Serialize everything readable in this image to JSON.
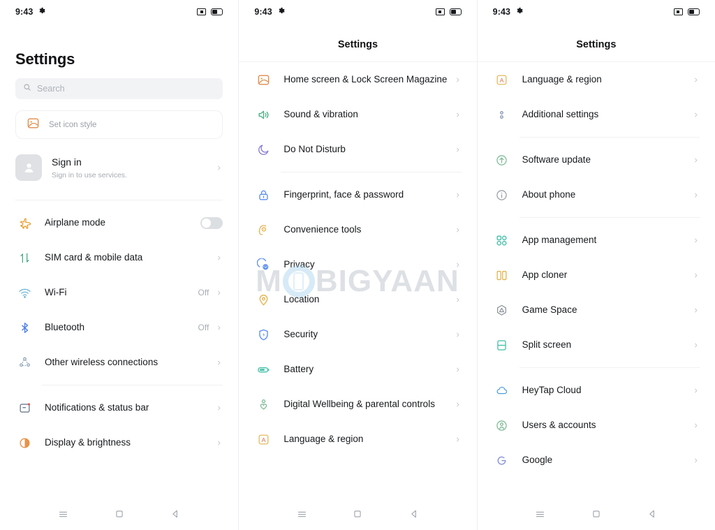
{
  "status_bar": {
    "time": "9:43",
    "left_icons": [
      "gear-icon"
    ],
    "right_icons": [
      "screen-recording-icon",
      "battery-icon"
    ]
  },
  "watermark": {
    "text_before": "M",
    "text_after": "BIGYAAN",
    "full": "MOBIGYAAN"
  },
  "nav_bar": {
    "recents_label": "recents",
    "home_label": "home",
    "back_label": "back"
  },
  "colors": {
    "orange": "#e8a33d",
    "orange_deep": "#e08a4a",
    "green": "#4caf83",
    "teal": "#3fbfa5",
    "blue": "#5b8def",
    "purple": "#8a7fd4",
    "gray": "#9aa0a7",
    "yellow": "#e3b24b",
    "red_a": "#d9704f",
    "text": "#16191c",
    "muted": "#a9aeb4"
  },
  "panel1": {
    "title": "Settings",
    "search": {
      "placeholder": "Search",
      "value": "",
      "icon": "search-icon"
    },
    "icon_style": {
      "label": "Set icon style",
      "icon": "image-icon"
    },
    "account": {
      "title": "Sign in",
      "subtitle": "Sign in to use services.",
      "icon": "person-avatar-icon"
    },
    "items": [
      {
        "label": "Airplane mode",
        "icon": "airplane-icon",
        "color": "#e8a33d",
        "control": "toggle",
        "toggle_on": false,
        "value": ""
      },
      {
        "label": "SIM card & mobile data",
        "icon": "sim-arrows-icon",
        "color": "#4caf83",
        "control": "chevron",
        "value": ""
      },
      {
        "label": "Wi-Fi",
        "icon": "wifi-icon",
        "color": "#6fb7d8",
        "control": "chevron",
        "value": "Off"
      },
      {
        "label": "Bluetooth",
        "icon": "bluetooth-icon",
        "color": "#4b7fe8",
        "control": "chevron",
        "value": ""
      },
      {
        "label": "Other wireless connections",
        "icon": "share-nodes-icon",
        "color": "#8fa3b8",
        "control": "chevron",
        "value": ""
      },
      {
        "label": "Notifications & status bar",
        "icon": "notification-card-icon",
        "color": "#6d7b8d",
        "control": "chevron",
        "value": "",
        "divider_before": true
      },
      {
        "label": "Display & brightness",
        "icon": "brightness-icon",
        "color": "#e8924a",
        "control": "chevron",
        "value": ""
      }
    ],
    "bluetooth_value": "Off"
  },
  "panel2": {
    "title": "Settings",
    "items": [
      {
        "label": "Home screen & Lock Screen Magazine",
        "icon": "image-icon",
        "color": "#e08a4a",
        "value": ""
      },
      {
        "label": "Sound & vibration",
        "icon": "speaker-icon",
        "color": "#4caf83",
        "value": ""
      },
      {
        "label": "Do Not Disturb",
        "icon": "moon-icon",
        "color": "#8a7fd4",
        "value": ""
      },
      {
        "label": "Fingerprint, face & password",
        "icon": "lock-icon",
        "color": "#5b8def",
        "value": "",
        "divider_before": true
      },
      {
        "label": "Convenience tools",
        "icon": "head-gear-icon",
        "color": "#e3b24b",
        "value": ""
      },
      {
        "label": "Privacy",
        "icon": "privacy-shield-icon",
        "color": "#5b8def",
        "value": ""
      },
      {
        "label": "Location",
        "icon": "location-pin-icon",
        "color": "#e3b24b",
        "value": ""
      },
      {
        "label": "Security",
        "icon": "security-shield-icon",
        "color": "#5b8def",
        "value": ""
      },
      {
        "label": "Battery",
        "icon": "battery-icon",
        "color": "#3fbfa5",
        "value": ""
      },
      {
        "label": "Digital Wellbeing & parental controls",
        "icon": "wellbeing-heart-icon",
        "color": "#7fbb96",
        "value": ""
      },
      {
        "label": "Language & region",
        "icon": "letter-a-icon",
        "color": "#d9704f",
        "value": ""
      }
    ]
  },
  "panel3": {
    "title": "Settings",
    "items": [
      {
        "label": "Language & region",
        "icon": "letter-a-icon",
        "color": "#d9704f",
        "value": ""
      },
      {
        "label": "Additional settings",
        "icon": "dots-vertical-icon",
        "color": "#7f93b5",
        "value": ""
      },
      {
        "label": "Software update",
        "icon": "update-arrow-icon",
        "color": "#7fbb96",
        "value": "",
        "divider_before": true
      },
      {
        "label": "About phone",
        "icon": "info-icon",
        "color": "#9aa0a7",
        "value": ""
      },
      {
        "label": "App management",
        "icon": "grid-apps-icon",
        "color": "#3fbfa5",
        "value": "",
        "divider_before": true
      },
      {
        "label": "App cloner",
        "icon": "app-cloner-icon",
        "color": "#e3b24b",
        "value": ""
      },
      {
        "label": "Game Space",
        "icon": "game-hexagon-icon",
        "color": "#8d949c",
        "value": ""
      },
      {
        "label": "Split screen",
        "icon": "split-screen-icon",
        "color": "#3fbfa5",
        "value": ""
      },
      {
        "label": "HeyTap Cloud",
        "icon": "cloud-icon",
        "color": "#4e9fe0",
        "value": "",
        "divider_before": true
      },
      {
        "label": "Users & accounts",
        "icon": "user-circle-icon",
        "color": "#7fbb96",
        "value": ""
      },
      {
        "label": "Google",
        "icon": "google-g-icon",
        "color": "#7b88d6",
        "value": ""
      }
    ]
  }
}
